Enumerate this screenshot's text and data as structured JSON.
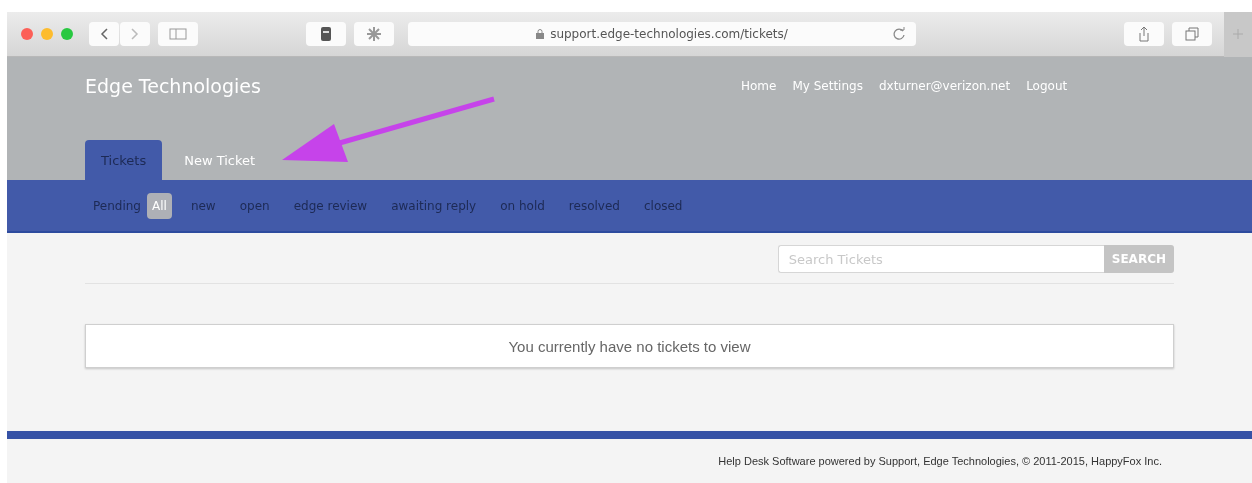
{
  "browser": {
    "url": "support.edge-technologies.com/tickets/"
  },
  "header": {
    "brand": "Edge Technologies",
    "links": [
      "Home",
      "My Settings",
      "dxturner@verizon.net",
      "Logout"
    ]
  },
  "tabs": [
    {
      "label": "Tickets",
      "selected": true
    },
    {
      "label": "New Ticket",
      "selected": false
    }
  ],
  "filter_bar": {
    "label": "Pending",
    "filters": [
      {
        "label": "All",
        "selected": true
      },
      {
        "label": "new",
        "selected": false
      },
      {
        "label": "open",
        "selected": false
      },
      {
        "label": "edge review",
        "selected": false
      },
      {
        "label": "awaiting reply",
        "selected": false
      },
      {
        "label": "on hold",
        "selected": false
      },
      {
        "label": "resolved",
        "selected": false
      },
      {
        "label": "closed",
        "selected": false
      }
    ]
  },
  "search": {
    "placeholder": "Search Tickets",
    "button": "SEARCH"
  },
  "empty_message": "You currently have no tickets to view",
  "footer": "Help Desk Software powered by Support, Edge Technologies, © 2011-2015, HappyFox Inc."
}
